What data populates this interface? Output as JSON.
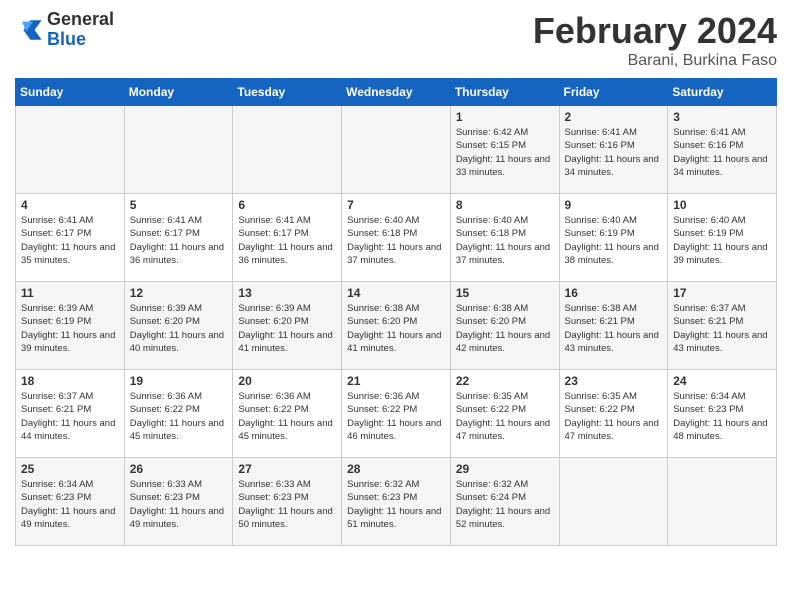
{
  "header": {
    "logo": {
      "general": "General",
      "blue": "Blue"
    },
    "title": "February 2024",
    "subtitle": "Barani, Burkina Faso"
  },
  "days_of_week": [
    "Sunday",
    "Monday",
    "Tuesday",
    "Wednesday",
    "Thursday",
    "Friday",
    "Saturday"
  ],
  "weeks": [
    [
      {
        "day": "",
        "sunrise": "",
        "sunset": "",
        "daylight": ""
      },
      {
        "day": "",
        "sunrise": "",
        "sunset": "",
        "daylight": ""
      },
      {
        "day": "",
        "sunrise": "",
        "sunset": "",
        "daylight": ""
      },
      {
        "day": "",
        "sunrise": "",
        "sunset": "",
        "daylight": ""
      },
      {
        "day": "1",
        "sunrise": "6:42 AM",
        "sunset": "6:15 PM",
        "daylight": "11 hours and 33 minutes."
      },
      {
        "day": "2",
        "sunrise": "6:41 AM",
        "sunset": "6:16 PM",
        "daylight": "11 hours and 34 minutes."
      },
      {
        "day": "3",
        "sunrise": "6:41 AM",
        "sunset": "6:16 PM",
        "daylight": "11 hours and 34 minutes."
      }
    ],
    [
      {
        "day": "4",
        "sunrise": "6:41 AM",
        "sunset": "6:17 PM",
        "daylight": "11 hours and 35 minutes."
      },
      {
        "day": "5",
        "sunrise": "6:41 AM",
        "sunset": "6:17 PM",
        "daylight": "11 hours and 36 minutes."
      },
      {
        "day": "6",
        "sunrise": "6:41 AM",
        "sunset": "6:17 PM",
        "daylight": "11 hours and 36 minutes."
      },
      {
        "day": "7",
        "sunrise": "6:40 AM",
        "sunset": "6:18 PM",
        "daylight": "11 hours and 37 minutes."
      },
      {
        "day": "8",
        "sunrise": "6:40 AM",
        "sunset": "6:18 PM",
        "daylight": "11 hours and 37 minutes."
      },
      {
        "day": "9",
        "sunrise": "6:40 AM",
        "sunset": "6:19 PM",
        "daylight": "11 hours and 38 minutes."
      },
      {
        "day": "10",
        "sunrise": "6:40 AM",
        "sunset": "6:19 PM",
        "daylight": "11 hours and 39 minutes."
      }
    ],
    [
      {
        "day": "11",
        "sunrise": "6:39 AM",
        "sunset": "6:19 PM",
        "daylight": "11 hours and 39 minutes."
      },
      {
        "day": "12",
        "sunrise": "6:39 AM",
        "sunset": "6:20 PM",
        "daylight": "11 hours and 40 minutes."
      },
      {
        "day": "13",
        "sunrise": "6:39 AM",
        "sunset": "6:20 PM",
        "daylight": "11 hours and 41 minutes."
      },
      {
        "day": "14",
        "sunrise": "6:38 AM",
        "sunset": "6:20 PM",
        "daylight": "11 hours and 41 minutes."
      },
      {
        "day": "15",
        "sunrise": "6:38 AM",
        "sunset": "6:20 PM",
        "daylight": "11 hours and 42 minutes."
      },
      {
        "day": "16",
        "sunrise": "6:38 AM",
        "sunset": "6:21 PM",
        "daylight": "11 hours and 43 minutes."
      },
      {
        "day": "17",
        "sunrise": "6:37 AM",
        "sunset": "6:21 PM",
        "daylight": "11 hours and 43 minutes."
      }
    ],
    [
      {
        "day": "18",
        "sunrise": "6:37 AM",
        "sunset": "6:21 PM",
        "daylight": "11 hours and 44 minutes."
      },
      {
        "day": "19",
        "sunrise": "6:36 AM",
        "sunset": "6:22 PM",
        "daylight": "11 hours and 45 minutes."
      },
      {
        "day": "20",
        "sunrise": "6:36 AM",
        "sunset": "6:22 PM",
        "daylight": "11 hours and 45 minutes."
      },
      {
        "day": "21",
        "sunrise": "6:36 AM",
        "sunset": "6:22 PM",
        "daylight": "11 hours and 46 minutes."
      },
      {
        "day": "22",
        "sunrise": "6:35 AM",
        "sunset": "6:22 PM",
        "daylight": "11 hours and 47 minutes."
      },
      {
        "day": "23",
        "sunrise": "6:35 AM",
        "sunset": "6:22 PM",
        "daylight": "11 hours and 47 minutes."
      },
      {
        "day": "24",
        "sunrise": "6:34 AM",
        "sunset": "6:23 PM",
        "daylight": "11 hours and 48 minutes."
      }
    ],
    [
      {
        "day": "25",
        "sunrise": "6:34 AM",
        "sunset": "6:23 PM",
        "daylight": "11 hours and 49 minutes."
      },
      {
        "day": "26",
        "sunrise": "6:33 AM",
        "sunset": "6:23 PM",
        "daylight": "11 hours and 49 minutes."
      },
      {
        "day": "27",
        "sunrise": "6:33 AM",
        "sunset": "6:23 PM",
        "daylight": "11 hours and 50 minutes."
      },
      {
        "day": "28",
        "sunrise": "6:32 AM",
        "sunset": "6:23 PM",
        "daylight": "11 hours and 51 minutes."
      },
      {
        "day": "29",
        "sunrise": "6:32 AM",
        "sunset": "6:24 PM",
        "daylight": "11 hours and 52 minutes."
      },
      {
        "day": "",
        "sunrise": "",
        "sunset": "",
        "daylight": ""
      },
      {
        "day": "",
        "sunrise": "",
        "sunset": "",
        "daylight": ""
      }
    ]
  ]
}
